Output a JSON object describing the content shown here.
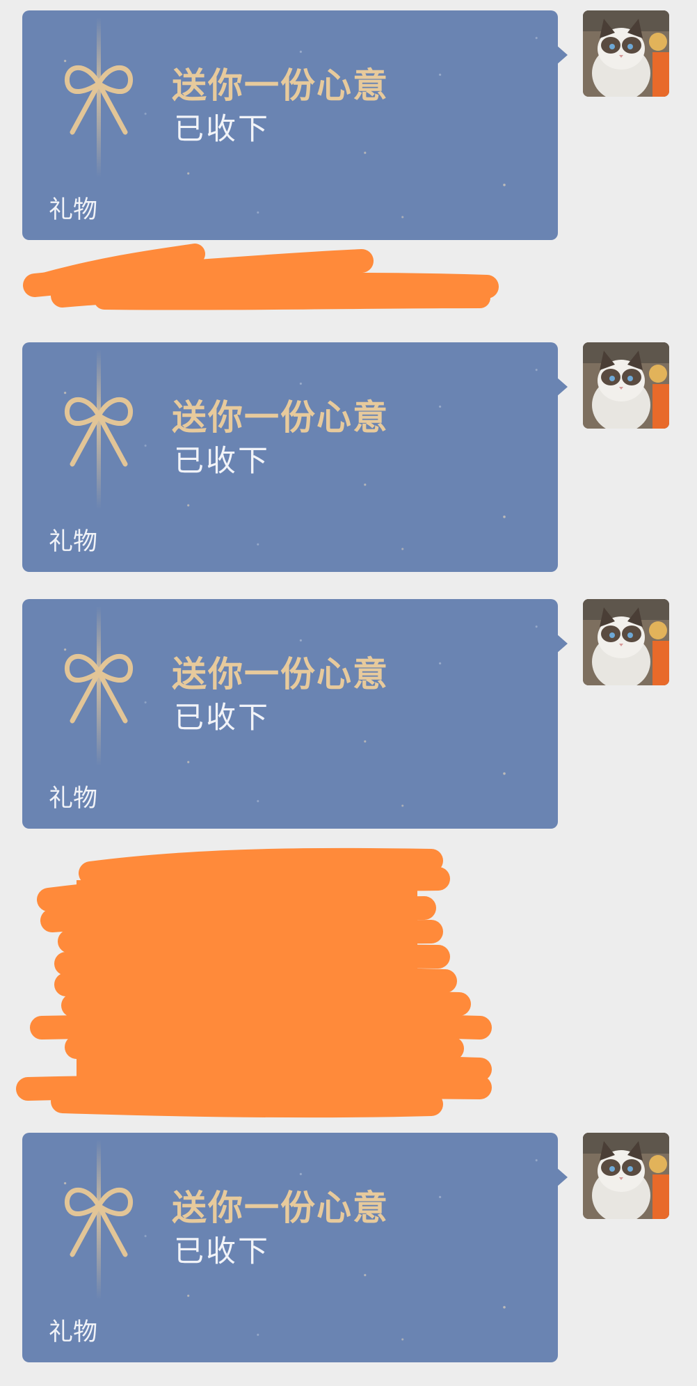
{
  "messages": [
    {
      "title": "送你一份心意",
      "status": "已收下",
      "footer": "礼物"
    },
    {
      "title": "送你一份心意",
      "status": "已收下",
      "footer": "礼物"
    },
    {
      "title": "送你一份心意",
      "status": "已收下",
      "footer": "礼物"
    },
    {
      "title": "送你一份心意",
      "status": "已收下",
      "footer": "礼物"
    }
  ],
  "avatar": {
    "icon": "cat-avatar-icon"
  },
  "gift_icon": {
    "icon": "bow-icon"
  },
  "colors": {
    "background": "#EDEDED",
    "bubble": "#6A84B2",
    "title": "#E7CA9C",
    "text": "#F1F3F8",
    "redaction": "#FF8A3A"
  }
}
